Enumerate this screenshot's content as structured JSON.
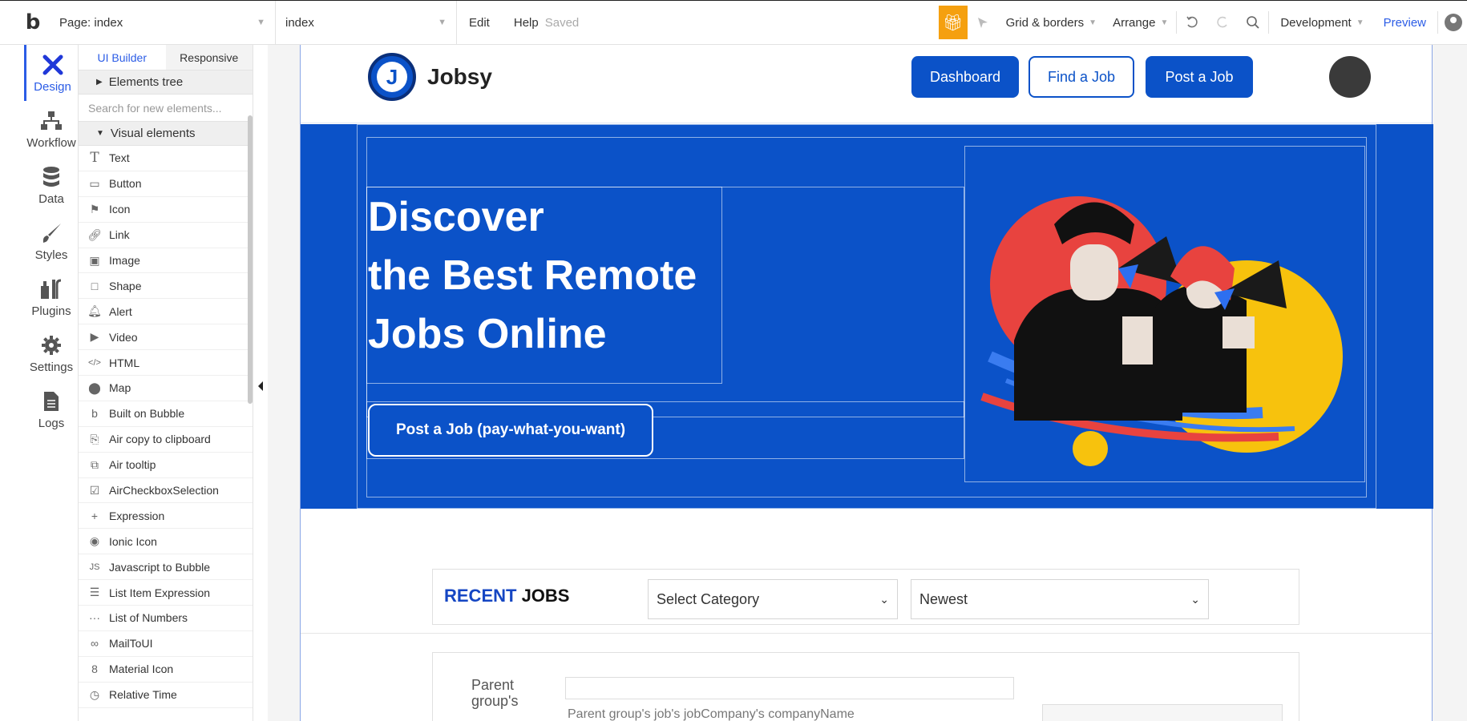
{
  "toolbar": {
    "page_label": "Page: index",
    "page_select": "index",
    "edit": "Edit",
    "help": "Help",
    "saved": "Saved",
    "grid": "Grid & borders",
    "arrange": "Arrange",
    "development": "Development",
    "preview": "Preview"
  },
  "rail": [
    {
      "label": "Design",
      "icon": "design-icon"
    },
    {
      "label": "Workflow",
      "icon": "workflow-icon"
    },
    {
      "label": "Data",
      "icon": "data-icon"
    },
    {
      "label": "Styles",
      "icon": "styles-icon"
    },
    {
      "label": "Plugins",
      "icon": "plugins-icon"
    },
    {
      "label": "Settings",
      "icon": "settings-icon"
    },
    {
      "label": "Logs",
      "icon": "logs-icon"
    }
  ],
  "panel": {
    "tab_builder": "UI Builder",
    "tab_responsive": "Responsive",
    "elements_tree": "Elements tree",
    "search_placeholder": "Search for new elements...",
    "visual_elements": "Visual elements",
    "items": [
      {
        "label": "Text",
        "icon": "text-icon"
      },
      {
        "label": "Button",
        "icon": "button-icon"
      },
      {
        "label": "Icon",
        "icon": "flag-icon"
      },
      {
        "label": "Link",
        "icon": "link-icon"
      },
      {
        "label": "Image",
        "icon": "image-icon"
      },
      {
        "label": "Shape",
        "icon": "shape-icon"
      },
      {
        "label": "Alert",
        "icon": "bell-icon"
      },
      {
        "label": "Video",
        "icon": "video-icon"
      },
      {
        "label": "HTML",
        "icon": "code-icon"
      },
      {
        "label": "Map",
        "icon": "map-pin-icon"
      },
      {
        "label": "Built on Bubble",
        "icon": "bubble-icon"
      },
      {
        "label": "Air copy to clipboard",
        "icon": "clipboard-icon"
      },
      {
        "label": "Air tooltip",
        "icon": "tooltip-icon"
      },
      {
        "label": "AirCheckboxSelection",
        "icon": "checkbox-icon"
      },
      {
        "label": "Expression",
        "icon": "plus-icon"
      },
      {
        "label": "Ionic Icon",
        "icon": "ionic-icon"
      },
      {
        "label": "Javascript to Bubble",
        "icon": "js-icon"
      },
      {
        "label": "List Item Expression",
        "icon": "list-expr-icon"
      },
      {
        "label": "List of Numbers",
        "icon": "dots-icon"
      },
      {
        "label": "MailToUI",
        "icon": "mail-icon"
      },
      {
        "label": "Material Icon",
        "icon": "material-icon"
      },
      {
        "label": "Relative Time",
        "icon": "clock-icon"
      }
    ]
  },
  "app": {
    "brand": "Jobsy",
    "logo_letter": "J",
    "nav_dashboard": "Dashboard",
    "nav_find": "Find a Job",
    "nav_post": "Post a Job",
    "hero_line1": "Discover",
    "hero_line2": "the Best Remote",
    "hero_line3": "Jobs Online",
    "hero_button": "Post a Job (pay-what-you-want)",
    "recent_blue": "RECENT",
    "recent_dark": " JOBS",
    "category_select": "Select Category",
    "sort_select": "Newest",
    "rg_text1": "Parent group's",
    "rg_text2": "Parent group's job's jobCompany's companyName"
  },
  "colors": {
    "brand_blue": "#0b52c8",
    "accent_blue": "#2b5ce6",
    "gift_orange": "#f5a00f"
  }
}
